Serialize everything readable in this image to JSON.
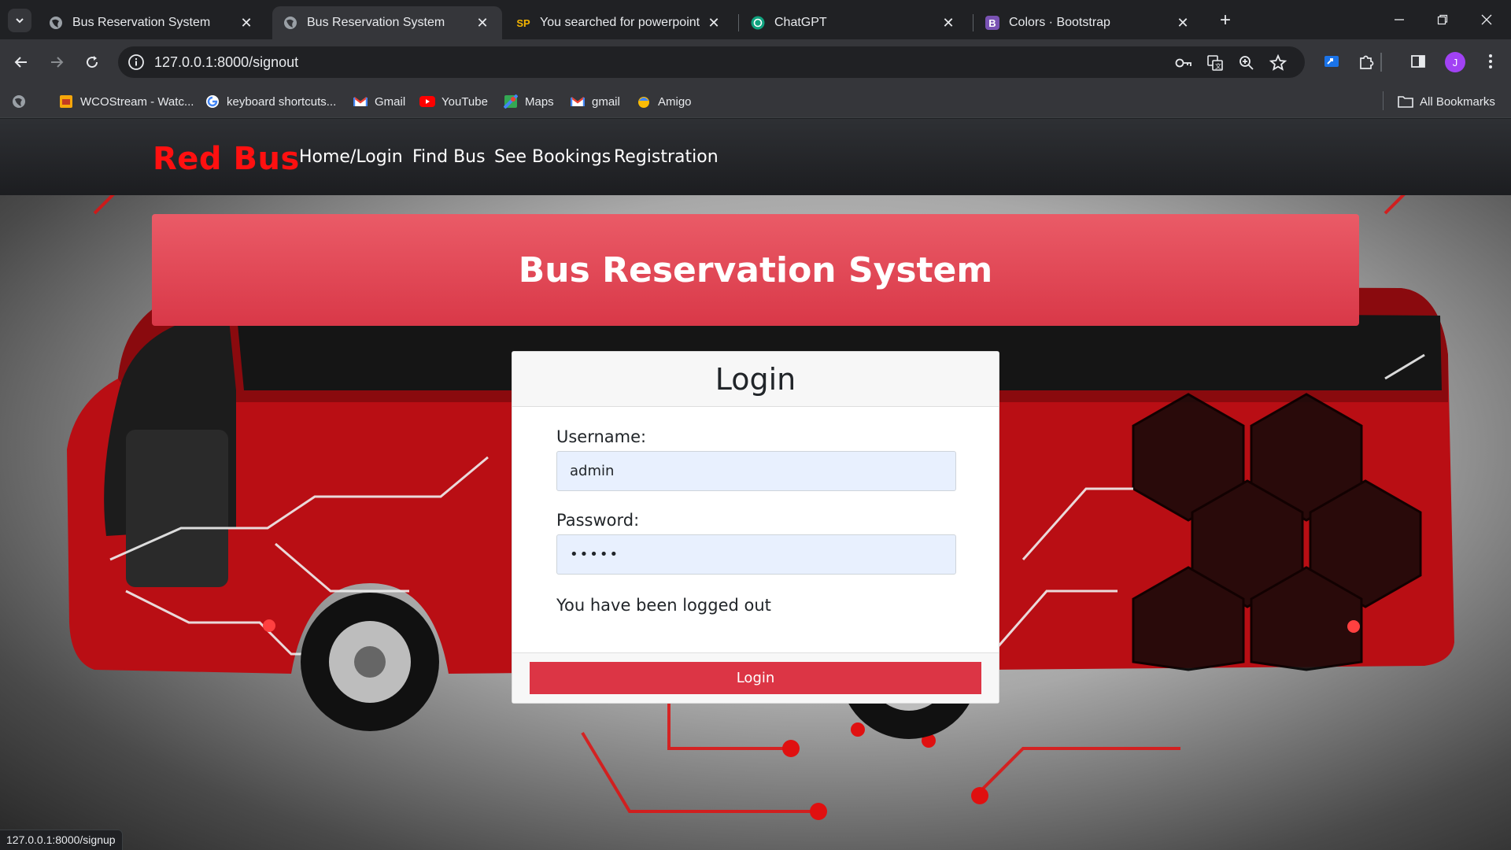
{
  "browser": {
    "tabs": [
      {
        "title": "Bus Reservation System",
        "favicon": "globe-icon",
        "active": false
      },
      {
        "title": "Bus Reservation System",
        "favicon": "globe-icon",
        "active": true
      },
      {
        "title": "You searched for powerpoint - S",
        "favicon": "sp-icon",
        "favicon_text": "SP",
        "active": false
      },
      {
        "title": "ChatGPT",
        "favicon": "chatgpt-icon",
        "active": false
      },
      {
        "title": "Colors · Bootstrap",
        "favicon": "bootstrap-icon",
        "favicon_text": "B",
        "active": false
      }
    ],
    "url": "127.0.0.1:8000/signout",
    "profile_initial": "J",
    "bookmarks": [
      {
        "label": "WCOStream - Watc...",
        "icon": "wcostream-icon"
      },
      {
        "label": "keyboard shortcuts...",
        "icon": "google-icon"
      },
      {
        "label": "Gmail",
        "icon": "gmail-icon"
      },
      {
        "label": "YouTube",
        "icon": "youtube-icon"
      },
      {
        "label": "Maps",
        "icon": "maps-icon"
      },
      {
        "label": "gmail",
        "icon": "gmail-icon"
      },
      {
        "label": "Amigo",
        "icon": "amigo-icon"
      }
    ],
    "all_bookmarks": "All Bookmarks",
    "status_url": "127.0.0.1:8000/signup"
  },
  "site": {
    "brand": "Red Bus",
    "nav": [
      "Home/Login",
      "Find Bus",
      "See Bookings",
      "Registration"
    ],
    "banner_title": "Bus Reservation System"
  },
  "login": {
    "heading": "Login",
    "username_label": "Username:",
    "username_value": "admin",
    "password_label": "Password:",
    "password_value": "•••••",
    "message": "You have been logged out",
    "button": "Login"
  },
  "colors": {
    "brand": "#ff1010",
    "banner": "#dc3545",
    "button": "#dc3545",
    "autofill": "#e8f0fe"
  }
}
